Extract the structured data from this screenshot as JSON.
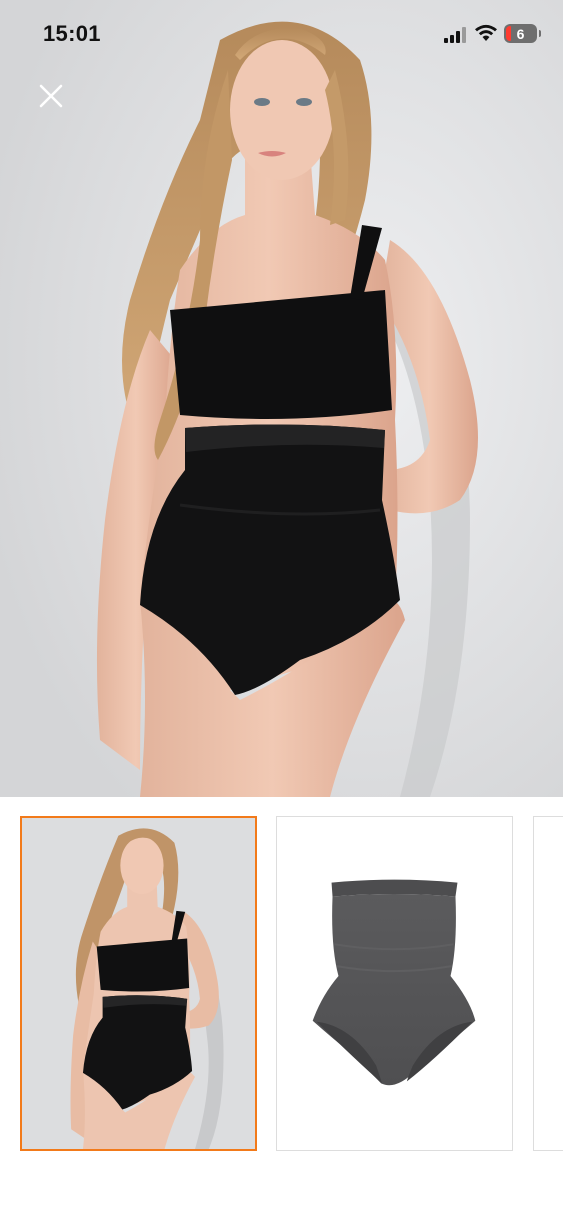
{
  "status_bar": {
    "time": "15:01",
    "battery_level": "6",
    "signal_icon": "cellular-signal-icon",
    "wifi_icon": "wifi-icon",
    "battery_icon": "battery-icon",
    "battery_low_color": "#ff3b30"
  },
  "close_button": {
    "icon": "close-icon"
  },
  "gallery": {
    "selected_index": 0,
    "accent_color": "#f27a1a",
    "thumbnails": [
      {
        "image": "model-wearing-black-shapewear-photo"
      },
      {
        "image": "grey-high-waist-shapewear-product-photo"
      },
      {
        "image": "product-photo-partial"
      }
    ]
  }
}
